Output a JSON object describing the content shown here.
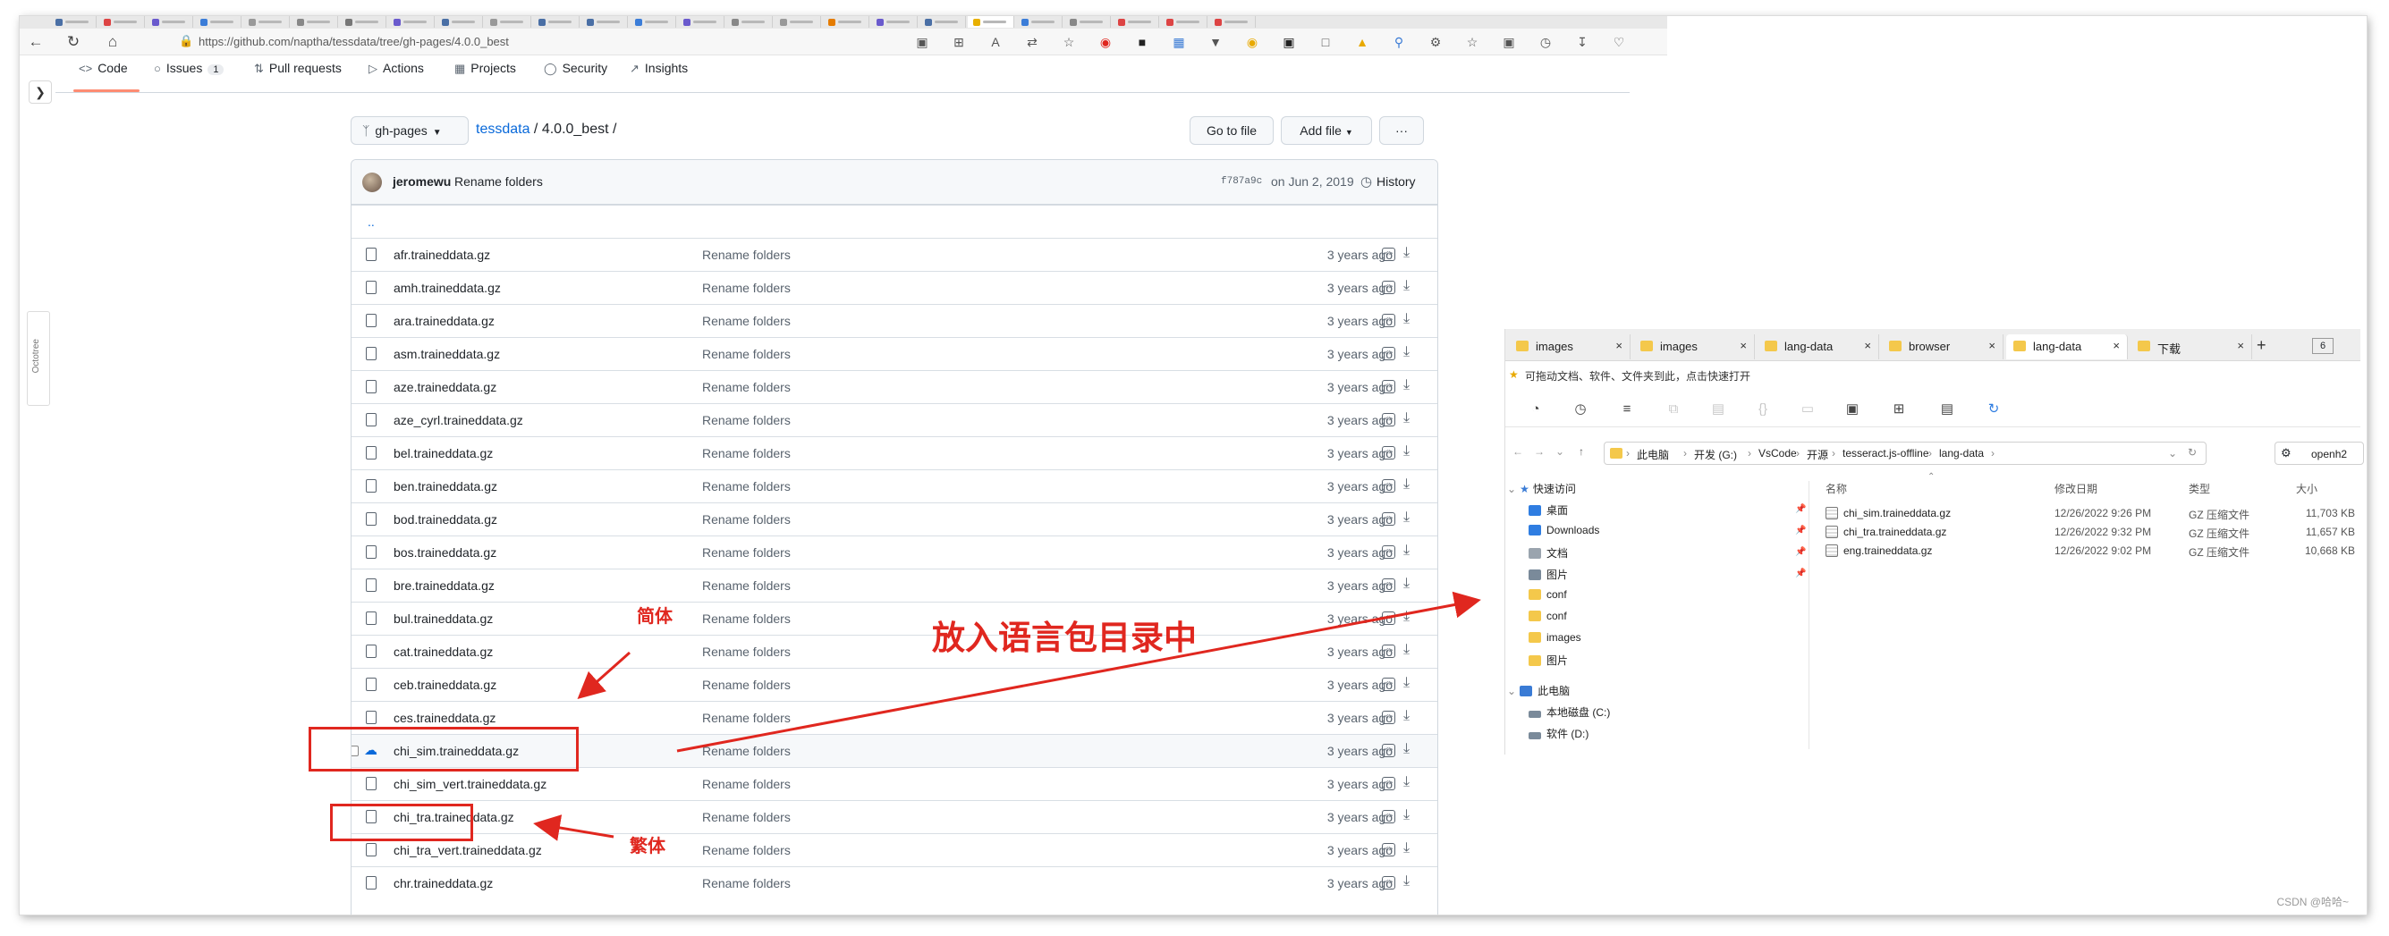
{
  "browser": {
    "url": "https://github.com/naptha/tessdata/tree/gh-pages/4.0.0_best",
    "tab_favicon_colors": [
      "#4a6fa5",
      "#d44",
      "#6a5acd",
      "#3b7dd8",
      "#999",
      "#888",
      "#777",
      "#6a5acd",
      "#4a6fa5",
      "#999",
      "#4a6fa5",
      "#4a6fa5",
      "#3b7dd8",
      "#6a5acd",
      "#888",
      "#999",
      "#e57c00",
      "#6a5acd",
      "#4a6fa5",
      "#e8b000",
      "#3b7dd8",
      "#888",
      "#d44",
      "#d44",
      "#d44"
    ],
    "extensions": [
      "reader-icon",
      "grid-icon",
      "font-icon",
      "translate-icon",
      "star-icon",
      "abp-icon",
      "ext-icon",
      "image-icon",
      "funnel-icon",
      "palette-icon",
      "puzzle-icon",
      "copy-icon",
      "ext2-icon",
      "search-icon",
      "gear-icon",
      "favorites-icon",
      "collections-icon",
      "history-icon",
      "download-icon",
      "heart-icon"
    ]
  },
  "repo_nav": {
    "tabs": [
      {
        "icon": "code-icon",
        "label": "Code"
      },
      {
        "icon": "issues-icon",
        "label": "Issues",
        "count": "1"
      },
      {
        "icon": "pull-request-icon",
        "label": "Pull requests"
      },
      {
        "icon": "actions-icon",
        "label": "Actions"
      },
      {
        "icon": "projects-icon",
        "label": "Projects"
      },
      {
        "icon": "security-icon",
        "label": "Security"
      },
      {
        "icon": "insights-icon",
        "label": "Insights"
      }
    ]
  },
  "toolbar": {
    "branch": "gh-pages",
    "crumb_repo": "tessdata",
    "crumb_path": " / 4.0.0_best /",
    "go_to_file": "Go to file",
    "add_file": "Add file",
    "more": "···"
  },
  "commit": {
    "author": "jeromewu",
    "message": "Rename folders",
    "sha": "f787a9c",
    "date": "on Jun 2, 2019",
    "history": "History"
  },
  "parent_dir": "..",
  "files": [
    {
      "name": "afr.traineddata.gz",
      "message": "Rename folders",
      "age": "3 years ago"
    },
    {
      "name": "amh.traineddata.gz",
      "message": "Rename folders",
      "age": "3 years ago"
    },
    {
      "name": "ara.traineddata.gz",
      "message": "Rename folders",
      "age": "3 years ago"
    },
    {
      "name": "asm.traineddata.gz",
      "message": "Rename folders",
      "age": "3 years ago"
    },
    {
      "name": "aze.traineddata.gz",
      "message": "Rename folders",
      "age": "3 years ago"
    },
    {
      "name": "aze_cyrl.traineddata.gz",
      "message": "Rename folders",
      "age": "3 years ago"
    },
    {
      "name": "bel.traineddata.gz",
      "message": "Rename folders",
      "age": "3 years ago"
    },
    {
      "name": "ben.traineddata.gz",
      "message": "Rename folders",
      "age": "3 years ago"
    },
    {
      "name": "bod.traineddata.gz",
      "message": "Rename folders",
      "age": "3 years ago"
    },
    {
      "name": "bos.traineddata.gz",
      "message": "Rename folders",
      "age": "3 years ago"
    },
    {
      "name": "bre.traineddata.gz",
      "message": "Rename folders",
      "age": "3 years ago"
    },
    {
      "name": "bul.traineddata.gz",
      "message": "Rename folders",
      "age": "3 years ago"
    },
    {
      "name": "cat.traineddata.gz",
      "message": "Rename folders",
      "age": "3 years ago"
    },
    {
      "name": "ceb.traineddata.gz",
      "message": "Rename folders",
      "age": "3 years ago"
    },
    {
      "name": "ces.traineddata.gz",
      "message": "Rename folders",
      "age": "3 years ago"
    },
    {
      "name": "chi_sim.traineddata.gz",
      "message": "Rename folders",
      "age": "3 years ago"
    },
    {
      "name": "chi_sim_vert.traineddata.gz",
      "message": "Rename folders",
      "age": "3 years ago"
    },
    {
      "name": "chi_tra.traineddata.gz",
      "message": "Rename folders",
      "age": "3 years ago"
    },
    {
      "name": "chi_tra_vert.traineddata.gz",
      "message": "Rename folders",
      "age": "3 years ago"
    },
    {
      "name": "chr.traineddata.gz",
      "message": "Rename folders",
      "age": "3 years ago"
    }
  ],
  "annotations": {
    "simplified": "简体",
    "traditional": "繁体",
    "instruction": "放入语言包目录中"
  },
  "explorer": {
    "tabs": [
      "images",
      "images",
      "lang-data",
      "browser",
      "lang-data",
      "下载"
    ],
    "tab_count": "6",
    "quick_access_hint": "可拖动文档、软件、文件夹到此，点击快速打开",
    "breadcrumb": [
      "此电脑",
      "开发 (G:)",
      "VsCode",
      "开源",
      "tesseract.js-offline",
      "lang-data"
    ],
    "search_placeholder": "openh2",
    "nav": {
      "quick_access": "快速访问",
      "items": [
        "桌面",
        "Downloads",
        "文档",
        "图片",
        "conf",
        "conf",
        "images",
        "图片"
      ],
      "this_pc": "此电脑",
      "drives": [
        "本地磁盘 (C:)",
        "软件 (D:)"
      ]
    },
    "columns": [
      "名称",
      "修改日期",
      "类型",
      "大小"
    ],
    "files": [
      {
        "name": "chi_sim.traineddata.gz",
        "date": "12/26/2022 9:26 PM",
        "type": "GZ 压缩文件",
        "size": "11,703 KB"
      },
      {
        "name": "chi_tra.traineddata.gz",
        "date": "12/26/2022 9:32 PM",
        "type": "GZ 压缩文件",
        "size": "11,657 KB"
      },
      {
        "name": "eng.traineddata.gz",
        "date": "12/26/2022 9:02 PM",
        "type": "GZ 压缩文件",
        "size": "10,668 KB"
      }
    ]
  },
  "watermark": "CSDN @哈哈~"
}
